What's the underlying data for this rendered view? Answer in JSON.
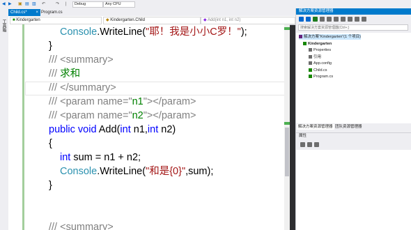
{
  "toolbar": {
    "debug_label": "Debug",
    "cpu_label": "Any CPU"
  },
  "left_strip": {
    "toolbox_label": "工具箱"
  },
  "tabs": [
    {
      "label": "Child.cs*",
      "close": "×"
    },
    {
      "label": "Program.cs"
    }
  ],
  "navbar": {
    "project": "Kindergarten",
    "class": "Kindergarten.Child",
    "member": "Add(int n1, int n2)"
  },
  "code_lines": [
    {
      "segments": [
        {
          "text": "Console",
          "cls": "ty"
        },
        {
          "text": ".WriteLine(",
          "cls": ""
        },
        {
          "text": "\"耶！我是小小C罗！\"",
          "cls": "st"
        },
        {
          "text": ");",
          "cls": ""
        }
      ]
    },
    {
      "segments": [
        {
          "text": "}",
          "cls": ""
        }
      ]
    },
    {
      "segments": [
        {
          "text": "/// <summary>",
          "cls": "cm"
        }
      ]
    },
    {
      "segments": [
        {
          "text": "/// ",
          "cls": "cm"
        },
        {
          "text": "求和",
          "cls": "cmg"
        }
      ]
    },
    {
      "segments": [
        {
          "text": "/// </summary>",
          "cls": "cm"
        }
      ]
    },
    {
      "segments": [
        {
          "text": "/// <param name=\"",
          "cls": "cm"
        },
        {
          "text": "n1",
          "cls": "cmg"
        },
        {
          "text": "\"></param>",
          "cls": "cm"
        }
      ]
    },
    {
      "segments": [
        {
          "text": "/// <param name=\"",
          "cls": "cm"
        },
        {
          "text": "n2",
          "cls": "cmg"
        },
        {
          "text": "\"></param>",
          "cls": "cm"
        }
      ]
    },
    {
      "segments": [
        {
          "text": "public ",
          "cls": "kw"
        },
        {
          "text": "void ",
          "cls": "kw"
        },
        {
          "text": "Add(",
          "cls": ""
        },
        {
          "text": "int ",
          "cls": "kw"
        },
        {
          "text": "n1,",
          "cls": ""
        },
        {
          "text": "int ",
          "cls": "kw"
        },
        {
          "text": "n2)",
          "cls": ""
        }
      ]
    },
    {
      "segments": [
        {
          "text": "{",
          "cls": ""
        }
      ]
    },
    {
      "segments": [
        {
          "text": "int ",
          "cls": "kw"
        },
        {
          "text": "sum = n1 + n2;",
          "cls": ""
        }
      ]
    },
    {
      "segments": [
        {
          "text": "Console",
          "cls": "ty"
        },
        {
          "text": ".WriteLine(",
          "cls": ""
        },
        {
          "text": "\"和是{0}\"",
          "cls": "st"
        },
        {
          "text": ",sum);",
          "cls": ""
        }
      ]
    },
    {
      "segments": [
        {
          "text": "}",
          "cls": ""
        }
      ]
    },
    {
      "segments": [
        {
          "text": "",
          "cls": ""
        }
      ]
    },
    {
      "segments": [
        {
          "text": "",
          "cls": ""
        }
      ]
    },
    {
      "segments": [
        {
          "text": "/// <summary>",
          "cls": "cm"
        }
      ]
    }
  ],
  "solution_explorer": {
    "title": "解决方案资源管理器",
    "search_placeholder": "搜索解决方案资源管理器(Ctrl+;)",
    "tree": [
      {
        "label": "解决方案“Kindergarten”(1 个项目)",
        "icon_color": "#68217a"
      },
      {
        "label": "Kindergarten",
        "icon_color": "#178600",
        "bold": true
      },
      {
        "label": "Properties",
        "icon_color": "#6d6d6d"
      },
      {
        "label": "引用",
        "icon_color": "#6d6d6d"
      },
      {
        "label": "App.config",
        "icon_color": "#6d6d6d"
      },
      {
        "label": "Child.cs",
        "icon_color": "#178600"
      },
      {
        "label": "Program.cs",
        "icon_color": "#178600"
      }
    ],
    "tab_se": "解决方案资源管理器",
    "tab_team": "团队资源管理器"
  },
  "properties": {
    "title": "属性"
  },
  "colors": {
    "accent": "#007acc",
    "keyword": "#0000ff",
    "type": "#2b91af",
    "comment": "#808080",
    "comment_text": "#008000",
    "string": "#a31515"
  }
}
